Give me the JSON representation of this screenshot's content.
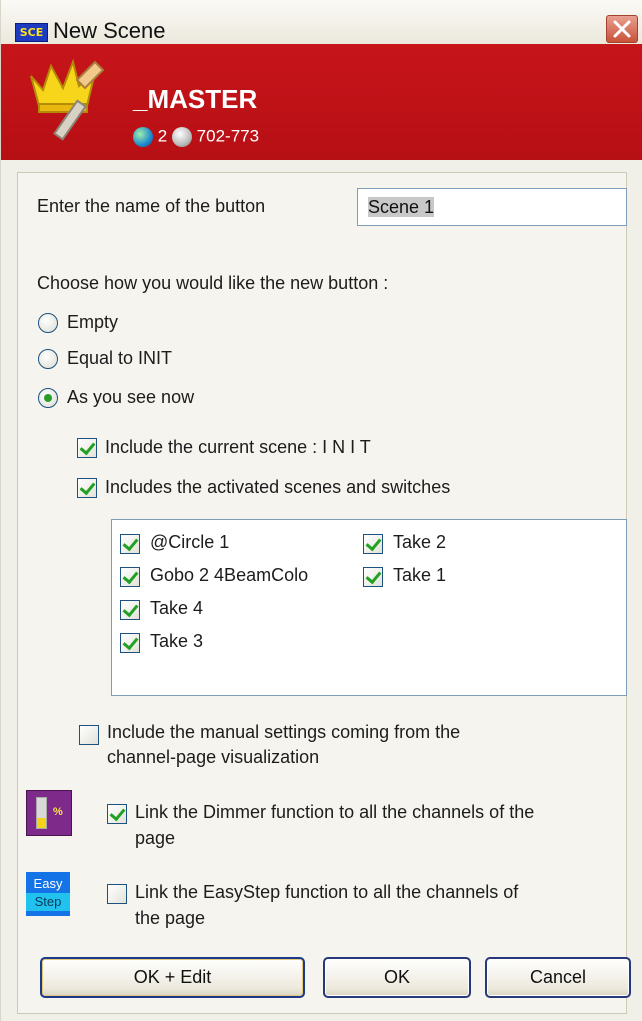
{
  "window": {
    "badge": "SCE",
    "title": "New Scene"
  },
  "header": {
    "title": "_MASTER",
    "universe_count": "2",
    "channel_range": "702-773"
  },
  "form": {
    "name_label": "Enter the name of the button",
    "name_value": "Scene 1",
    "choose_label": "Choose how you would like the new button :",
    "options": [
      {
        "label": "Empty",
        "selected": false
      },
      {
        "label": "Equal to INIT",
        "selected": false
      },
      {
        "label": "As you see now",
        "selected": true
      }
    ],
    "include_current": {
      "label": "Include the current scene : I N I T",
      "checked": true
    },
    "include_activated": {
      "label": "Includes the activated scenes and switches",
      "checked": true
    },
    "scenes_col1": [
      {
        "label": "@Circle 1",
        "checked": true
      },
      {
        "label": "Gobo 2 4BeamColo",
        "checked": true
      },
      {
        "label": "Take  4",
        "checked": true
      },
      {
        "label": "Take  3",
        "checked": true
      }
    ],
    "scenes_col2": [
      {
        "label": "Take  2",
        "checked": true
      },
      {
        "label": "Take  1",
        "checked": true
      }
    ],
    "manual_settings": {
      "line1": "Include the manual settings coming from the",
      "line2": "channel-page visualization",
      "checked": false
    },
    "link_dimmer": {
      "line1": "Link the Dimmer function to all the channels of the",
      "line2": "page",
      "checked": true
    },
    "link_easystep": {
      "line1": "Link the EasyStep function to all the channels of",
      "line2": "the page",
      "checked": false
    },
    "dimmer_icon_text": "%",
    "easystep_icon_text": [
      "Easy",
      "Step"
    ]
  },
  "buttons": {
    "ok_edit": "OK + Edit",
    "ok": "OK",
    "cancel": "Cancel"
  },
  "colors": {
    "header_red": "#c7151a",
    "check_green": "#21a121",
    "button_border": "#1c3a8a"
  }
}
